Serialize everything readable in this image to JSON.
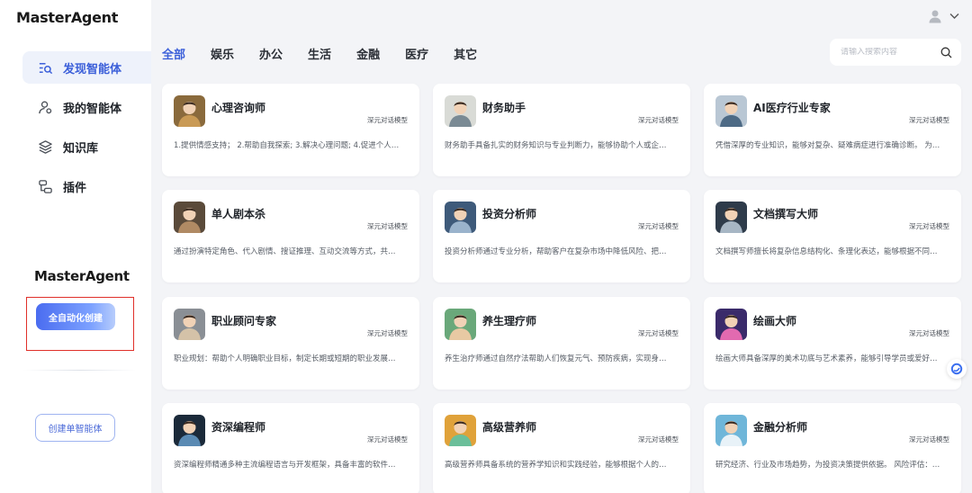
{
  "app": {
    "logo": "MasterAgent",
    "logo_secondary": "MasterAgent"
  },
  "sidebar": {
    "items": [
      {
        "label": "发现智能体",
        "icon": "discover-search-icon",
        "active": true
      },
      {
        "label": "我的智能体",
        "icon": "user-agent-icon",
        "active": false
      },
      {
        "label": "知识库",
        "icon": "layers-icon",
        "active": false
      },
      {
        "label": "插件",
        "icon": "plugin-icon",
        "active": false
      }
    ],
    "auto_create_label": "全自动化创建",
    "single_create_label": "创建单智能体"
  },
  "tabs": [
    {
      "label": "全部",
      "active": true
    },
    {
      "label": "娱乐",
      "active": false
    },
    {
      "label": "办公",
      "active": false
    },
    {
      "label": "生活",
      "active": false
    },
    {
      "label": "金融",
      "active": false
    },
    {
      "label": "医疗",
      "active": false
    },
    {
      "label": "其它",
      "active": false
    }
  ],
  "search": {
    "placeholder": "请输入搜索内容",
    "value": ""
  },
  "cards": [
    {
      "title": "心理咨询师",
      "model": "深元对话模型",
      "desc": "1.提供情感支持； 2.帮助自我探索; 3.解决心理问题; 4.促进个人…",
      "avatar": "psychologist-avatar",
      "colors": [
        "#8a6a3c",
        "#c99a55"
      ]
    },
    {
      "title": "财务助手",
      "model": "深元对话模型",
      "desc": "财务助手具备扎实的财务知识与专业判断力，能够协助个人或企…",
      "avatar": "finance-desk-avatar",
      "colors": [
        "#d9dbd6",
        "#7a8a94"
      ]
    },
    {
      "title": "AI医疗行业专家",
      "model": "深元对话模型",
      "desc": "凭借深厚的专业知识，能够对复杂、疑难病症进行准确诊断。 为…",
      "avatar": "doctor-avatar",
      "colors": [
        "#b9c7d4",
        "#4d6a85"
      ]
    },
    {
      "title": "单人剧本杀",
      "model": "深元对话模型",
      "desc": "通过扮演特定角色、代入剧情、搜证推理、互动交流等方式，共…",
      "avatar": "detective-avatar",
      "colors": [
        "#5a4a3a",
        "#b08a64"
      ]
    },
    {
      "title": "投资分析师",
      "model": "深元对话模型",
      "desc": "投资分析师通过专业分析，帮助客户在复杂市场中降低风险、把…",
      "avatar": "investor-avatar",
      "colors": [
        "#3e5a7a",
        "#9ab3cc"
      ]
    },
    {
      "title": "文档撰写大师",
      "model": "深元对话模型",
      "desc": "文档撰写师擅长将复杂信息结构化、条理化表达，能够根据不同…",
      "avatar": "writer-avatar",
      "colors": [
        "#2e3b4a",
        "#a7b6c4"
      ]
    },
    {
      "title": "职业顾问专家",
      "model": "深元对话模型",
      "desc": "职业规划：帮助个人明确职业目标，制定长期或短期的职业发展…",
      "avatar": "career-advisor-avatar",
      "colors": [
        "#8a8f95",
        "#d4c2a8"
      ]
    },
    {
      "title": "养生理疗师",
      "model": "深元对话模型",
      "desc": "养生治疗师通过自然疗法帮助人们恢复元气、预防疾病，实现身…",
      "avatar": "therapist-avatar",
      "colors": [
        "#6aa87a",
        "#e8c9a3"
      ]
    },
    {
      "title": "绘画大师",
      "model": "深元对话模型",
      "desc": "绘画大师具备深厚的美术功底与艺术素养，能够引导学员或爱好…",
      "avatar": "painter-avatar",
      "colors": [
        "#3a2a6a",
        "#e26ab0"
      ]
    },
    {
      "title": "资深编程师",
      "model": "深元对话模型",
      "desc": "资深编程师精通多种主流编程语言与开发框架，具备丰富的软件…",
      "avatar": "programmer-avatar",
      "colors": [
        "#1b2a3a",
        "#5a8ab3"
      ]
    },
    {
      "title": "高级营养师",
      "model": "深元对话模型",
      "desc": "高级营养师具备系统的营养学知识和实践经验，能够根据个人的…",
      "avatar": "nutritionist-avatar",
      "colors": [
        "#e0a23a",
        "#6bbf9a"
      ]
    },
    {
      "title": "金融分析师",
      "model": "深元对话模型",
      "desc": "研究经济、行业及市场趋势，为投资决策提供依据。 风险评估：…",
      "avatar": "analyst-avatar",
      "colors": [
        "#6fb6d9",
        "#e8f2f8"
      ]
    }
  ]
}
